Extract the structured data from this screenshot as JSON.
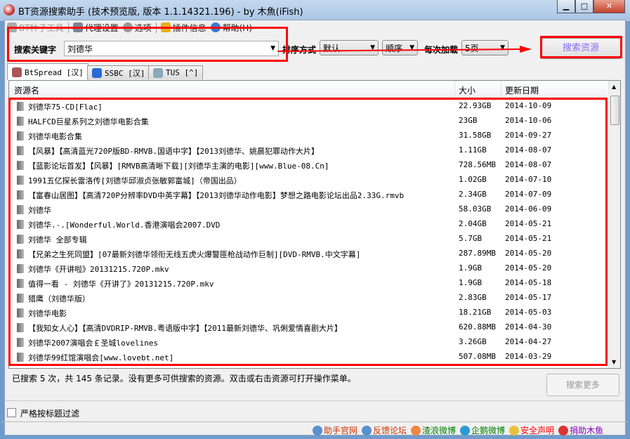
{
  "window": {
    "title": "BT资源搜索助手 (技术预览版, 版本 1.1.14321.196) - by 木魚(iFish)",
    "minimize": "▁",
    "maximize": "□",
    "close": "✕"
  },
  "toolbar": [
    {
      "label": "BT种子工具",
      "icon": "wrench-icon"
    },
    {
      "label": "代理设置",
      "icon": "proxy-icon"
    },
    {
      "label": "选项",
      "icon": "gear-icon"
    },
    {
      "label": "插件信息",
      "icon": "plugin-icon"
    },
    {
      "label": "帮助(H)",
      "icon": "help-icon"
    }
  ],
  "toolbar_more": "-",
  "search": {
    "label": "搜索关键字",
    "value": "刘德华",
    "sort_label": "排序方式",
    "sort_value": "默认",
    "order_value": "顺序",
    "load_label": "每次加载",
    "load_value": "5页",
    "search_button": "搜索资源"
  },
  "tabs": [
    "BtSpread [汉]",
    "SSBC [汉]",
    "TUS [^]"
  ],
  "columns": [
    "资源名",
    "大小",
    "更新日期"
  ],
  "rows": [
    [
      "刘德华75-CD[Flac]",
      "22.93GB",
      "2014-10-09"
    ],
    [
      "HALFCD巨星系列之刘德华电影合集",
      "23GB",
      "2014-10-06"
    ],
    [
      "刘德华电影合集",
      "31.58GB",
      "2014-09-27"
    ],
    [
      "【风暴】【高清蓝光720P版BD-RMVB.国语中字】【2013刘德华、姚晨犯罪动作大片】",
      "1.11GB",
      "2014-08-07"
    ],
    [
      "【蓝影论坛首发】【风暴】[RMVB高清晰下载][刘德华主演的电影][www.Blue-08.Cn]",
      "728.56MB",
      "2014-08-07"
    ],
    [
      "1991五亿探长雷洛传[刘德华邱淑贞张敏郭富城]（帝国出品）",
      "1.02GB",
      "2014-07-10"
    ],
    [
      "【富春山居图】【高清720P分辨率DVD中英字幕】【2013刘德华动作电影】梦想之路电影论坛出品2.33G.rmvb",
      "2.34GB",
      "2014-07-09"
    ],
    [
      "刘德华",
      "58.03GB",
      "2014-06-09"
    ],
    [
      "刘德华.-.[Wonderful.World.香港演唱会2007.DVD",
      "2.04GB",
      "2014-05-21"
    ],
    [
      "刘德华 全部专辑",
      "5.7GB",
      "2014-05-21"
    ],
    [
      "【兄弟之生死同盟】[07最新刘德华领衔无线五虎火爆警匪枪战动作巨制][DVD-RMVB.中文字幕]",
      "287.89MB",
      "2014-05-20"
    ],
    [
      "刘德华《开讲啦》20131215.720P.mkv",
      "1.9GB",
      "2014-05-20"
    ],
    [
      "值得一看 - 刘德华《开讲了》20131215.720P.mkv",
      "1.9GB",
      "2014-05-18"
    ],
    [
      "猎鹰（刘德华版）",
      "2.83GB",
      "2014-05-17"
    ],
    [
      "刘德华电影",
      "18.21GB",
      "2014-05-03"
    ],
    [
      "【我知女人心】【高清DVDRIP-RMVB.粤语版中字】【2011最新刘德华、巩俐爱情喜剧大片】",
      "620.88MB",
      "2014-04-30"
    ],
    [
      "刘德华2007演唱会￡圣城lovelines",
      "3.26GB",
      "2014-04-27"
    ],
    [
      "刘德华99红馆演唱会[www.lovebt.net]",
      "507.08MB",
      "2014-03-29"
    ]
  ],
  "status": {
    "text": "已搜索 5 次，共 145 条记录。没有更多可供搜索的资源。双击或右击资源可打开操作菜单。",
    "more_button": "搜索更多"
  },
  "filter_checkbox": "严格按标题过滤",
  "links": [
    {
      "label": "助手官网",
      "color": "#cc3300"
    },
    {
      "label": "反馈论坛",
      "color": "#cc3300"
    },
    {
      "label": "渣浪微博",
      "color": "#008000"
    },
    {
      "label": "企鹅微博",
      "color": "#008000"
    },
    {
      "label": "安全声明",
      "color": "#ff0000"
    },
    {
      "label": "捐助木鱼",
      "color": "#8000c0"
    }
  ],
  "colors": {
    "annotation": "#ff0000",
    "search_button_text": "#8a6cf0"
  }
}
